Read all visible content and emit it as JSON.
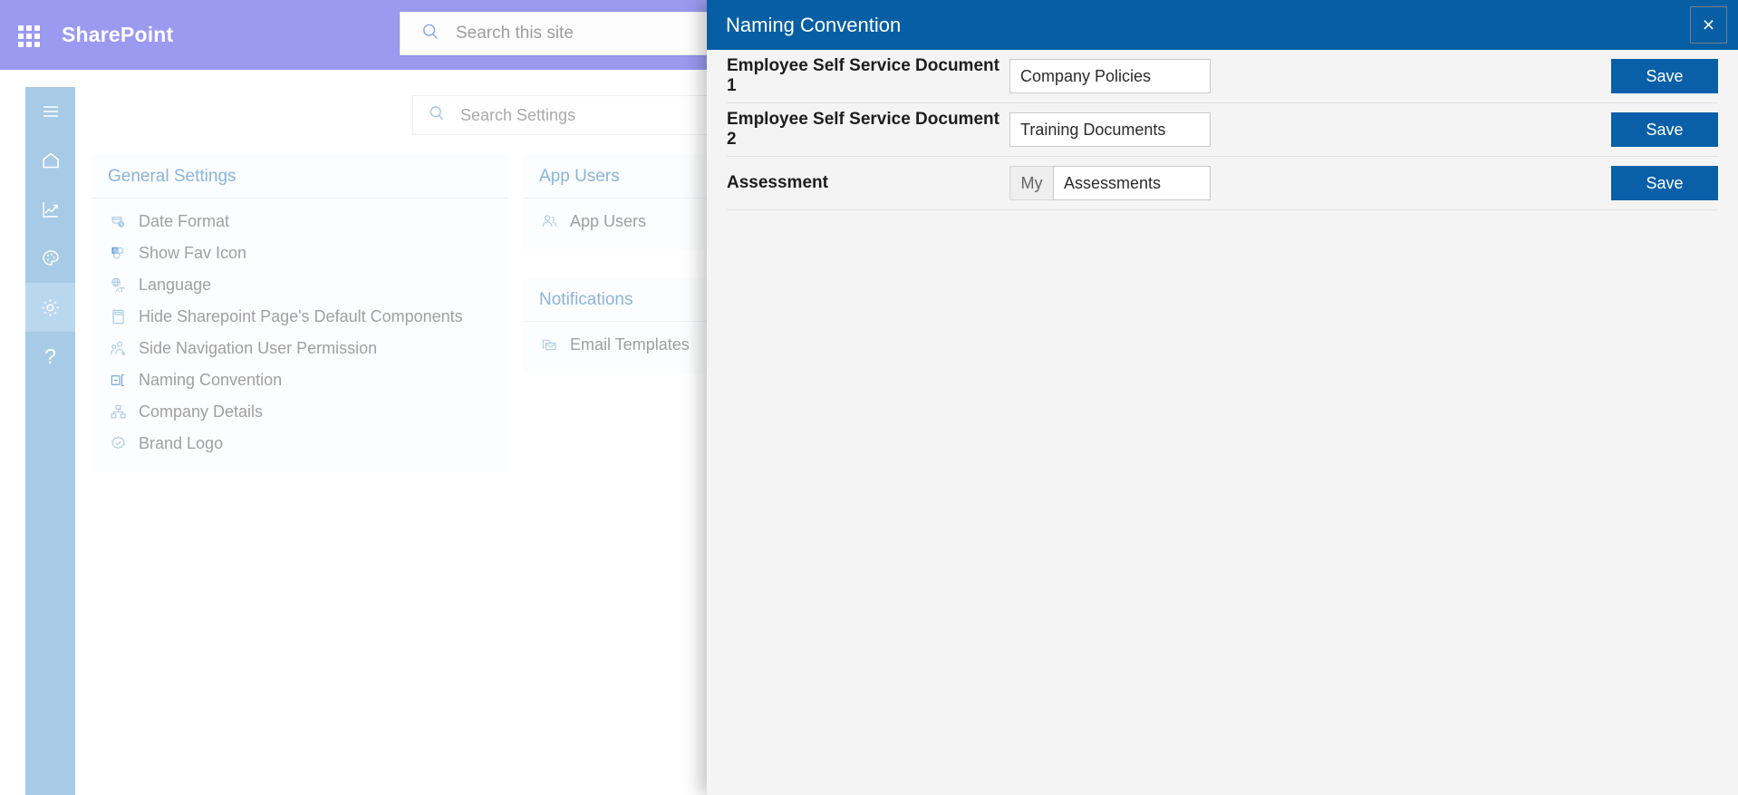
{
  "topbar": {
    "waffle_icon": "app-launcher-icon",
    "brand": "SharePoint",
    "search_icon": "search-icon",
    "search_placeholder": "Search this site",
    "search_value": ""
  },
  "rail": {
    "items": [
      {
        "icon": "hamburger-menu-icon",
        "name": "menu",
        "active": false
      },
      {
        "icon": "home-icon",
        "name": "home",
        "active": false
      },
      {
        "icon": "chart-trend-icon",
        "name": "analytics",
        "active": false
      },
      {
        "icon": "palette-icon",
        "name": "appearance",
        "active": false
      },
      {
        "icon": "gear-icon",
        "name": "settings",
        "active": true
      },
      {
        "icon": "question-mark-icon",
        "name": "help",
        "active": false,
        "glyph": "?"
      }
    ]
  },
  "settings_search": {
    "icon": "search-icon",
    "placeholder": "Search Settings",
    "value": ""
  },
  "cards": [
    {
      "title": "General Settings",
      "items": [
        {
          "label": "Date Format",
          "icon": "calendar-clock-icon"
        },
        {
          "label": "Show Fav Icon",
          "icon": "sharepoint-favicon-icon"
        },
        {
          "label": "Language",
          "icon": "globe-translate-icon"
        },
        {
          "label": "Hide Sharepoint Page's Default Components",
          "icon": "page-layout-icon"
        },
        {
          "label": "Side Navigation User Permission",
          "icon": "user-permission-icon"
        },
        {
          "label": "Naming Convention",
          "icon": "rename-tag-icon"
        },
        {
          "label": "Company Details",
          "icon": "org-chart-icon"
        },
        {
          "label": "Brand Logo",
          "icon": "badge-check-icon"
        }
      ]
    },
    {
      "title": "App Users",
      "items": [
        {
          "label": "App Users",
          "icon": "people-icon"
        }
      ]
    },
    {
      "title": "Notifications",
      "items": [
        {
          "label": "Email Templates",
          "icon": "email-template-icon"
        }
      ]
    }
  ],
  "panel": {
    "title": "Naming Convention",
    "close_icon": "close-icon",
    "close_label": "×",
    "rows": [
      {
        "label": "Employee Self Service Document 1",
        "prefix": null,
        "value": "Company Policies",
        "placeholder": "",
        "save_label": "Save"
      },
      {
        "label": "Employee Self Service Document 2",
        "prefix": null,
        "value": "Training Documents",
        "placeholder": "",
        "save_label": "Save"
      },
      {
        "label": "Assessment",
        "prefix": "My",
        "value": "Assessments",
        "placeholder": "",
        "save_label": "Save"
      }
    ]
  },
  "colors": {
    "topbar_purple": "#9a9af0",
    "rail_blue": "#a7cae6",
    "rail_active_blue": "#b9d7ef",
    "panel_header_blue": "#065fa5",
    "save_button_blue": "#0a60a8",
    "card_title_blue": "#8bb4d8",
    "panel_bg": "#f4f4f4"
  }
}
